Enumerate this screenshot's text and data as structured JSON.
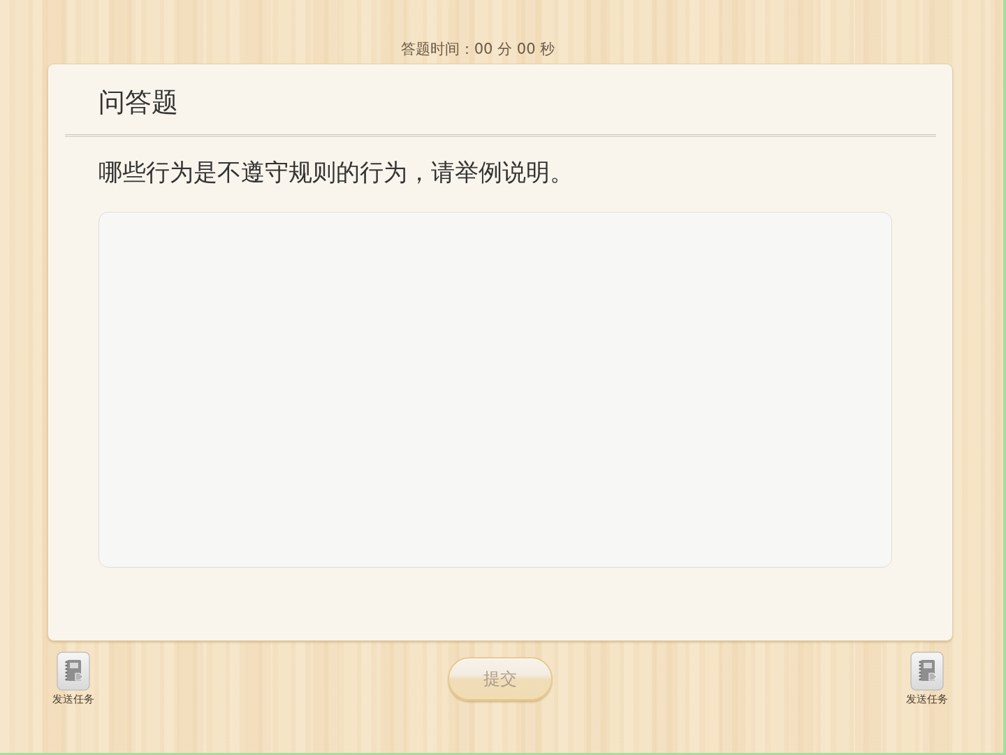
{
  "timer": {
    "text": "答题时间：00 分 00 秒"
  },
  "question": {
    "type_title": "问答题",
    "prompt": "哪些行为是不遵守规则的行为，请举例说明。"
  },
  "footer": {
    "side_buttons": [
      {
        "label": "发送任务"
      },
      {
        "label": "发送任务"
      }
    ],
    "submit": {
      "label": "提交",
      "disabled": true
    }
  }
}
